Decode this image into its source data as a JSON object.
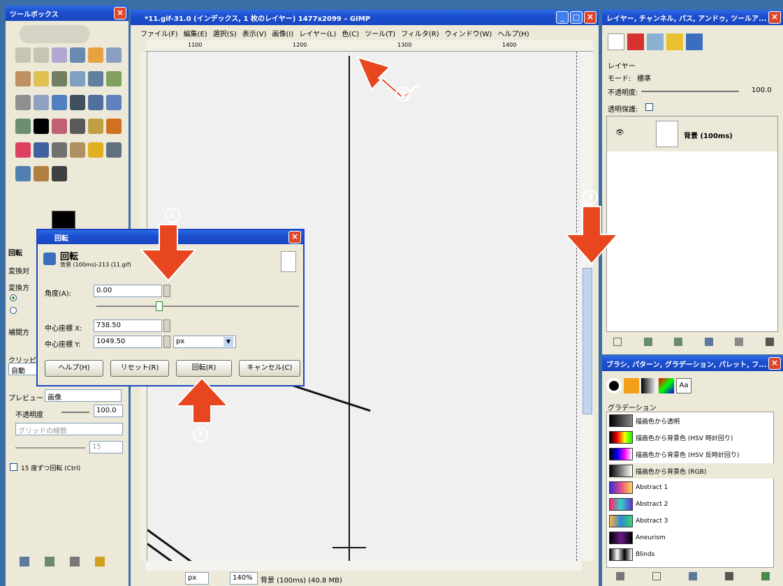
{
  "toolbox": {
    "title": "ツールボックス",
    "section_label": "回転",
    "transform_label": "変換対",
    "direction_label": "変換方",
    "interp_label": "補間方",
    "clip_label": "クリッピ",
    "clip_value": "自動",
    "preview_label": "プレビュー",
    "preview_value": "画像",
    "opacity_label": "不透明度",
    "opacity_value": "100.0",
    "grid_label": "グリッドの線数",
    "grid_value": "15",
    "constrain_label": "15 度ずつ回転 (Ctrl)"
  },
  "main_window": {
    "title": "*11.gif-31.0 (インデックス, 1 枚のレイヤー) 1477x2099 – GIMP",
    "menu": [
      "ファイル(F)",
      "編集(E)",
      "選択(S)",
      "表示(V)",
      "画像(I)",
      "レイヤー(L)",
      "色(C)",
      "ツール(T)",
      "フィルタ(R)",
      "ウィンドウ(W)",
      "ヘルプ(H)"
    ],
    "ruler_ticks": [
      "1100",
      "1200",
      "1300",
      "1400"
    ],
    "status_unit": "px",
    "status_zoom": "140%",
    "status_text": "背景 (100ms) (40.8 MB)"
  },
  "rotate_dialog": {
    "title": "回転",
    "header": "回転",
    "subheader": "背景 (100ms)-213 (11.gif)",
    "angle_label": "角度(A):",
    "angle_value": "0.00",
    "center_x_label": "中心座標 X:",
    "center_x_value": "738.50",
    "center_y_label": "中心座標 Y:",
    "center_y_value": "1049.50",
    "unit": "px",
    "angle_fraction": 0.5,
    "buttons": {
      "help": "ヘルプ(H)",
      "reset": "リセット(R)",
      "rotate": "回転(R)",
      "cancel": "キャンセル(C)"
    }
  },
  "layers_panel": {
    "title": "レイヤー, チャンネル, パス, アンドゥ, ツールア...",
    "layer_label": "レイヤー",
    "mode_label": "モード:",
    "mode_value": "標準",
    "opacity_label": "不透明度:",
    "opacity_value": "100.0",
    "lock_label": "透明保護:",
    "layer_name": "背景 (100ms)"
  },
  "brushes_panel": {
    "title": "ブラシ, パターン, グラデーション, パレット, フ...",
    "gradient_label": "グラデーション",
    "gradients": [
      {
        "name": "描画色から透明",
        "colors": [
          "#000000",
          "#888888"
        ]
      },
      {
        "name": "描画色から背景色 (HSV 時計回り)",
        "colors": [
          "#000000",
          "#ff0000",
          "#ffff00",
          "#00ff00"
        ]
      },
      {
        "name": "描画色から背景色 (HSV 反時計回り)",
        "colors": [
          "#000000",
          "#0000ff",
          "#ff00ff",
          "#ffffff"
        ]
      },
      {
        "name": "描画色から背景色 (RGB)",
        "colors": [
          "#000000",
          "#ffffff"
        ]
      },
      {
        "name": "Abstract 1",
        "colors": [
          "#3a2bd6",
          "#e44c8a",
          "#ffd84a"
        ]
      },
      {
        "name": "Abstract 2",
        "colors": [
          "#ff1e6e",
          "#2bd6c8",
          "#6c2bd6"
        ]
      },
      {
        "name": "Abstract 3",
        "colors": [
          "#ffb43a",
          "#2b8ad6",
          "#3ad66c"
        ]
      },
      {
        "name": "Aneurism",
        "colors": [
          "#000000",
          "#6a1b8a",
          "#000000"
        ]
      },
      {
        "name": "Blinds",
        "colors": [
          "#000000",
          "#ffffff",
          "#000000",
          "#ffffff"
        ]
      }
    ]
  },
  "annotations": {
    "step1": "①",
    "step2": "②",
    "step3": "③",
    "step4": "④",
    "arrow_color": "#e8461e"
  }
}
